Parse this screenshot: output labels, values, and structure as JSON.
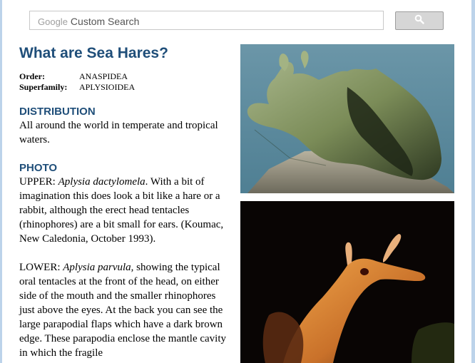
{
  "search": {
    "brand": "Google",
    "placeholder": "Custom Search"
  },
  "page": {
    "title": "What are Sea Hares?",
    "taxonomy": [
      {
        "label": "Order:",
        "value": "ANASPIDEA"
      },
      {
        "label": "Superfamily:",
        "value": "APLYSIOIDEA"
      }
    ],
    "distribution": {
      "heading": "DISTRIBUTION",
      "text": "All around the world in temperate and tropical waters."
    },
    "photo": {
      "heading": "PHOTO",
      "upper_prefix": "UPPER: ",
      "upper_species": "Aplysia dactylomela",
      "upper_text": ". With a bit of imagination this does look a bit like a hare or a rabbit, although the erect head tentacles (rhinophores) are a bit small for ears. (Koumac, New Caledonia, October 1993).",
      "lower_prefix": "LOWER: ",
      "lower_species": "Aplysia parvula",
      "lower_text": ", showing the typical oral tentacles at the front of the head, on either side of the mouth and the smaller rhinophores just above the eyes. At the back you can see the large parapodial flaps which have a dark brown edge. These parapodia enclose the mantle cavity in which the fragile"
    }
  },
  "colors": {
    "heading": "#1f4e79",
    "frame": "#bcd3ea"
  },
  "icons": {
    "search_button": "search-icon"
  }
}
